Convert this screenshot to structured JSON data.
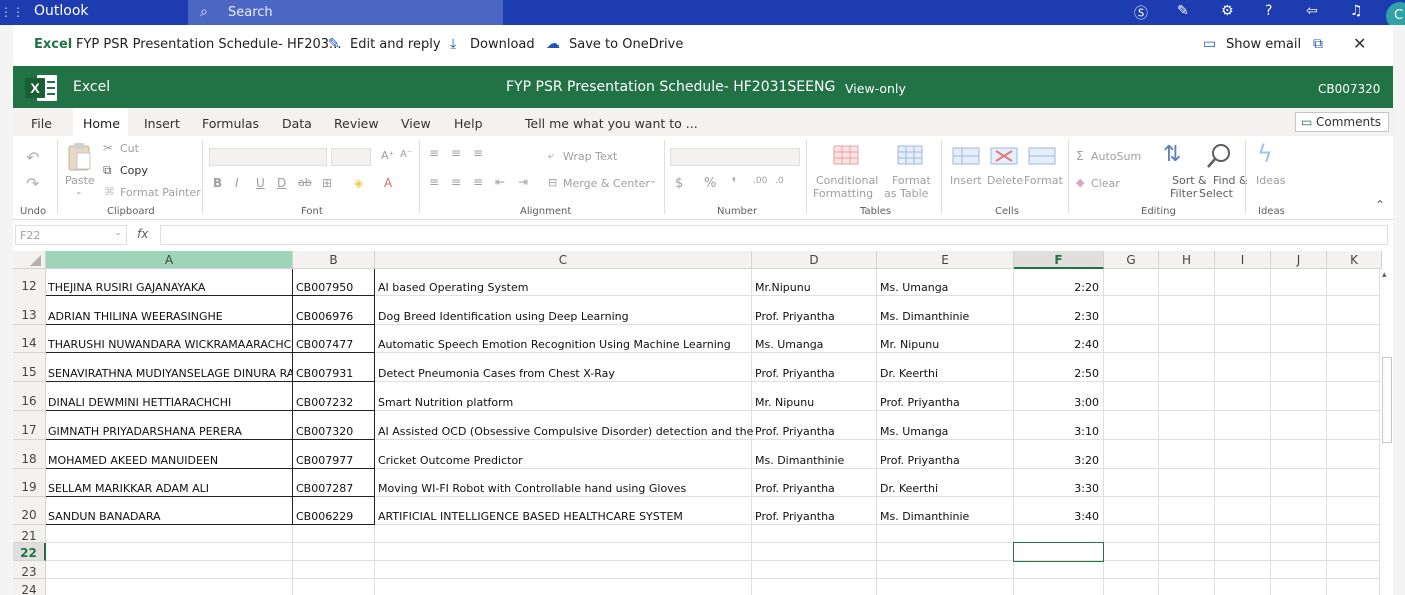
{
  "outlook": {
    "brand": "Outlook",
    "search_placeholder": "Search",
    "avatar_initial": "C"
  },
  "doc_header": {
    "app": "Excel",
    "file_title": "FYP PSR Presentation Schedule- HF203...",
    "edit_reply": "Edit and reply",
    "download": "Download",
    "save_onedrive": "Save to OneDrive",
    "show_email": "Show email"
  },
  "excel_bar": {
    "app": "Excel",
    "title": "FYP PSR Presentation Schedule- HF2031SEENG",
    "separator": "-",
    "mode": "View-only",
    "user_id": "CB007320"
  },
  "menu": {
    "tabs": [
      "File",
      "Home",
      "Insert",
      "Formulas",
      "Data",
      "Review",
      "View",
      "Help"
    ],
    "tell_me": "Tell me what you want to ...",
    "comments": "Comments"
  },
  "ribbon": {
    "paste": "Paste",
    "cut": "Cut",
    "copy": "Copy",
    "format_painter": "Format Painter",
    "wrap_text": "Wrap Text",
    "merge_center": "Merge & Center",
    "conditional_formatting": [
      "Conditional",
      "Formatting"
    ],
    "format_as_table": [
      "Format",
      "as Table"
    ],
    "insert": "Insert",
    "delete": "Delete",
    "format": "Format",
    "autosum": "AutoSum",
    "clear": "Clear",
    "sort_filter": [
      "Sort &",
      "Filter"
    ],
    "find_select": [
      "Find &",
      "Select"
    ],
    "ideas": "Ideas",
    "groups": {
      "undo": "Undo",
      "clipboard": "Clipboard",
      "font": "Font",
      "alignment": "Alignment",
      "number": "Number",
      "tables": "Tables",
      "cells": "Cells",
      "editing": "Editing",
      "ideas": "Ideas"
    }
  },
  "formula_bar": {
    "name_box": "F22",
    "fx": "fx",
    "formula": ""
  },
  "sheet": {
    "columns": [
      "A",
      "B",
      "C",
      "D",
      "E",
      "F",
      "G",
      "H",
      "I",
      "J",
      "K"
    ],
    "rows": [
      {
        "num": "12",
        "a": "THEJINA RUSIRI GAJANAYAKA",
        "b": "CB007950",
        "c": "AI based Operating System",
        "d": "Mr.Nipunu",
        "e": "Ms. Umanga",
        "f": "2:20"
      },
      {
        "num": "13",
        "a": "ADRIAN THILINA WEERASINGHE",
        "b": "CB006976",
        "c": "Dog Breed Identification using Deep Learning",
        "d": "Prof. Priyantha",
        "e": "Ms. Dimanthinie",
        "f": "2:30"
      },
      {
        "num": "14",
        "a": "THARUSHI NUWANDARA WICKRAMAARACHCHI",
        "b": "CB007477",
        "c": "Automatic Speech Emotion Recognition Using Machine Learning",
        "d": "Ms. Umanga",
        "e": "Mr. Nipunu",
        "f": "2:40"
      },
      {
        "num": "15",
        "a": "SENAVIRATHNA MUDIYANSELAGE DINURA RANDIKA",
        "b": "CB007931",
        "c": "Detect Pneumonia Cases from Chest X-Ray",
        "d": "Prof. Priyantha",
        "e": "Dr. Keerthi",
        "f": "2:50"
      },
      {
        "num": "16",
        "a": "DINALI DEWMINI HETTIARACHCHI",
        "b": "CB007232",
        "c": "Smart Nutrition platform",
        "d": "Mr. Nipunu",
        "e": "Prof. Priyantha",
        "f": "3:00"
      },
      {
        "num": "17",
        "a": "GIMNATH PRIYADARSHANA PERERA",
        "b": "CB007320",
        "c": "AI Assisted OCD (Obsessive Compulsive Disorder) detection and therapy",
        "d": "Prof. Priyantha",
        "e": "Ms. Umanga",
        "f": "3:10"
      },
      {
        "num": "18",
        "a": "MOHAMED AKEED MANUIDEEN",
        "b": "CB007977",
        "c": "Cricket Outcome Predictor",
        "d": "Ms. Dimanthinie",
        "e": "Prof. Priyantha",
        "f": "3:20"
      },
      {
        "num": "19",
        "a": "SELLAM MARIKKAR ADAM ALI",
        "b": "CB007287",
        "c": "Moving WI-FI Robot with Controllable hand using Gloves",
        "d": "Prof. Priyantha",
        "e": "Dr. Keerthi",
        "f": "3:30"
      },
      {
        "num": "20",
        "a": "SANDUN BANADARA",
        "b": "CB006229",
        "c": "ARTIFICIAL INTELLIGENCE BASED HEALTHCARE SYSTEM",
        "d": "Prof. Priyantha",
        "e": "Ms. Dimanthinie",
        "f": "3:40"
      }
    ],
    "empty_rows": [
      "21",
      "22",
      "23",
      "24"
    ],
    "selected_row": "22",
    "selected_col": "F"
  },
  "colors": {
    "outlook_blue": "#1d3cb0",
    "excel_green": "#217346",
    "selected_header": "#9fd5b7"
  }
}
